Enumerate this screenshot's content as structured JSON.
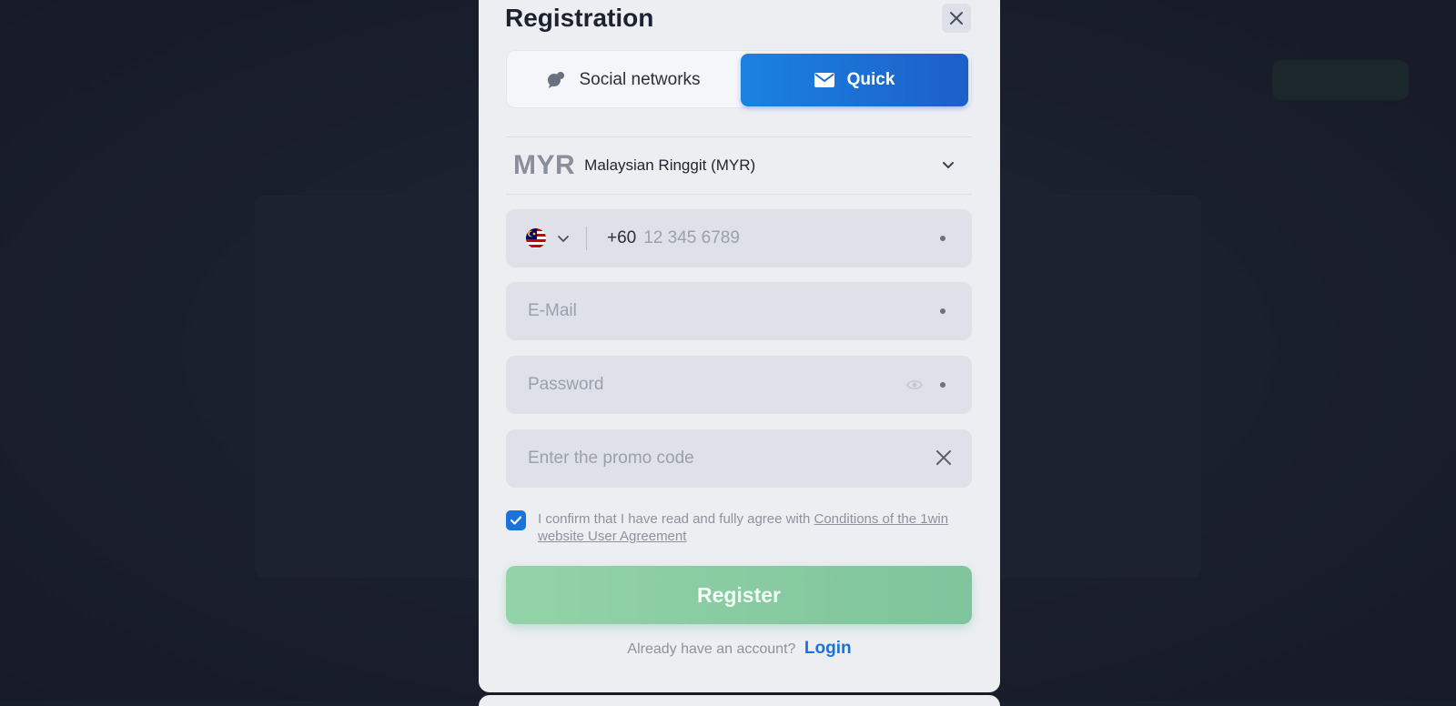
{
  "modal": {
    "title": "Registration"
  },
  "tabs": [
    {
      "label": "Social networks",
      "icon": "chat-bubbles-icon",
      "active": false
    },
    {
      "label": "Quick",
      "icon": "envelope-icon",
      "active": true
    }
  ],
  "currency": {
    "code": "MYR",
    "name": "Malaysian Ringgit (MYR)"
  },
  "phone": {
    "country_flag": "malaysia-flag-icon",
    "dial_code": "+60",
    "placeholder": "12 345 6789",
    "value": ""
  },
  "email": {
    "placeholder": "E-Mail",
    "value": ""
  },
  "password": {
    "placeholder": "Password",
    "value": ""
  },
  "promo": {
    "placeholder": "Enter the promo code",
    "value": ""
  },
  "agreement": {
    "checked": true,
    "text": "I confirm that I have read and fully agree with ",
    "link_text": "Conditions of the 1win website User Agreement"
  },
  "register": {
    "label": "Register"
  },
  "login": {
    "prompt": "Already have an account?",
    "link_label": "Login"
  },
  "colors": {
    "accent_blue": "#1a72da",
    "register_green": "#86cba0",
    "modal_bg": "#eceef2",
    "backdrop": "#1a1f2c"
  }
}
